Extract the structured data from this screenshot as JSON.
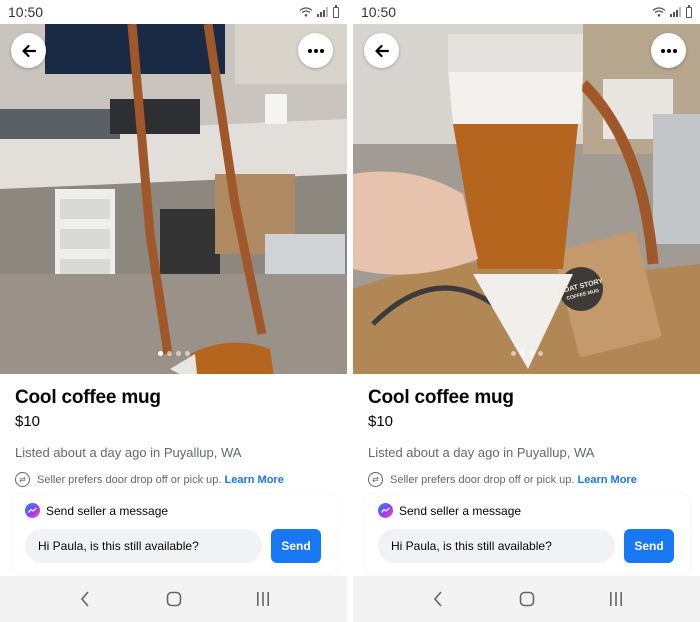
{
  "screens": [
    {
      "status": {
        "time": "10:50"
      },
      "listing": {
        "title": "Cool coffee mug",
        "price": "$10",
        "listed": "Listed about a day ago in Puyallup, WA",
        "preference": "Seller prefers door drop off or pick up.",
        "learn_more": "Learn More"
      },
      "message": {
        "heading": "Send seller a message",
        "input_value": "Hi Paula, is this still available?",
        "send_label": "Send"
      },
      "carousel": {
        "count": 4,
        "active_index": 0
      }
    },
    {
      "status": {
        "time": "10:50"
      },
      "listing": {
        "title": "Cool coffee mug",
        "price": "$10",
        "listed": "Listed about a day ago in Puyallup, WA",
        "preference": "Seller prefers door drop off or pick up.",
        "learn_more": "Learn More"
      },
      "message": {
        "heading": "Send seller a message",
        "input_value": "Hi Paula, is this still available?",
        "send_label": "Send"
      },
      "carousel": {
        "count": 4,
        "active_index": 1
      }
    }
  ],
  "icons": {
    "back": "arrow-left-icon",
    "more": "more-horizontal-icon",
    "preference": "swap-icon",
    "messenger": "messenger-icon",
    "nav_back": "chevron-left-icon",
    "nav_home": "home-icon",
    "nav_recents": "recents-icon"
  },
  "colors": {
    "accent": "#1877f2",
    "secondary_text": "#65676b",
    "input_bg": "#f0f2f5",
    "navbar_bg": "#f3f3f3"
  },
  "tag_label": {
    "line1": "GOAT STORY",
    "line2": "COFFEE MUG"
  }
}
